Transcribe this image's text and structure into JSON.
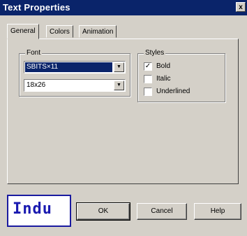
{
  "window": {
    "title": "Text Properties",
    "close_glyph": "x"
  },
  "tabs": [
    {
      "label": "General",
      "active": true
    },
    {
      "label": "Colors",
      "active": false
    },
    {
      "label": "Animation",
      "active": false
    }
  ],
  "font_group": {
    "label": "Font",
    "font_name": "SBITS×11",
    "font_size": "18x26"
  },
  "styles_group": {
    "label": "Styles",
    "options": [
      {
        "label": "Bold",
        "checked": true
      },
      {
        "label": "Italic",
        "checked": false
      },
      {
        "label": "Underlined",
        "checked": false
      }
    ]
  },
  "preview": {
    "text": "Indu"
  },
  "buttons": {
    "ok": "OK",
    "cancel": "Cancel",
    "help": "Help"
  },
  "icons": {
    "dropdown": "▼",
    "check": "✓"
  }
}
